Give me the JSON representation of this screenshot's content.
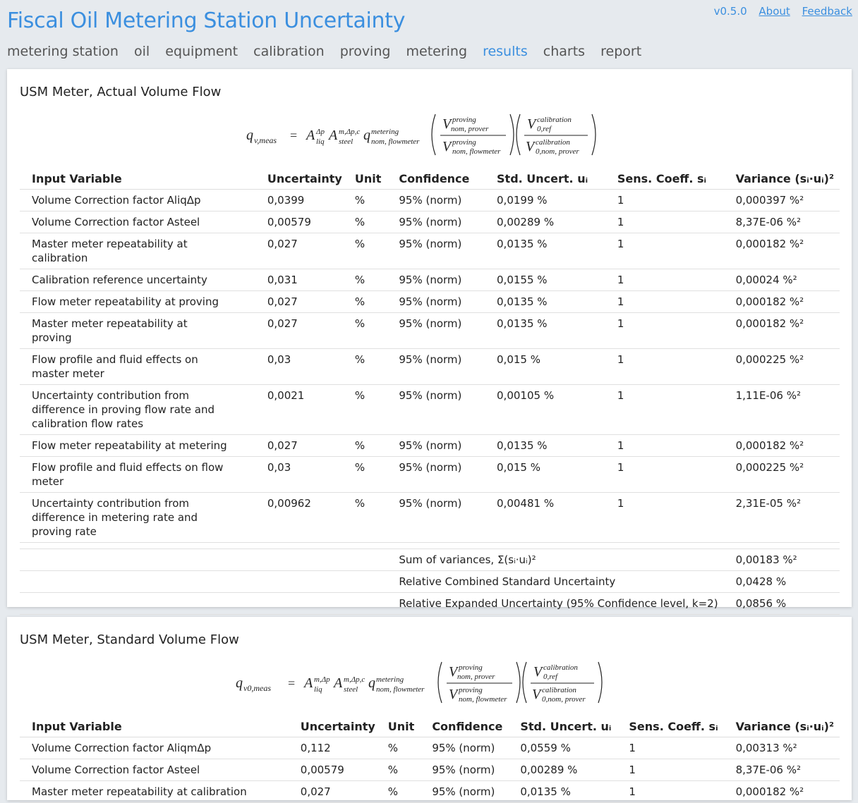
{
  "header": {
    "title": "Fiscal Oil Metering Station Uncertainty",
    "version": "v0.5.0",
    "about_label": "About",
    "feedback_label": "Feedback"
  },
  "nav": {
    "items": [
      "metering station",
      "oil",
      "equipment",
      "calibration",
      "proving",
      "metering",
      "results",
      "charts",
      "report"
    ],
    "active": "results"
  },
  "colors": {
    "accent": "#3b8fdf",
    "background": "#e6eaee",
    "card": "#ffffff"
  },
  "table_headers": {
    "input_variable": "Input Variable",
    "uncertainty": "Uncertainty",
    "unit": "Unit",
    "confidence": "Confidence",
    "std_uncert": "Std. Uncert. uᵢ",
    "sens_coeff": "Sens. Coeff. sᵢ",
    "variance": "Variance (sᵢ·uᵢ)²"
  },
  "cards": [
    {
      "title": "USM Meter, Actual Volume Flow",
      "formula_lhs": "q",
      "formula_lhs_sub": "v,meas",
      "rows": [
        {
          "name": "Volume Correction factor AliqΔp",
          "uncertainty": "0,0399",
          "unit": "%",
          "confidence": "95% (norm)",
          "std_uncert": "0,0199 %",
          "sens_coeff": "1",
          "variance": "0,000397 %²"
        },
        {
          "name": "Volume Correction factor Asteel",
          "uncertainty": "0,00579",
          "unit": "%",
          "confidence": "95% (norm)",
          "std_uncert": "0,00289 %",
          "sens_coeff": "1",
          "variance": "8,37E-06 %²"
        },
        {
          "name": "Master meter repeatability at calibration",
          "uncertainty": "0,027",
          "unit": "%",
          "confidence": "95% (norm)",
          "std_uncert": "0,0135 %",
          "sens_coeff": "1",
          "variance": "0,000182 %²"
        },
        {
          "name": "Calibration reference uncertainty",
          "uncertainty": "0,031",
          "unit": "%",
          "confidence": "95% (norm)",
          "std_uncert": "0,0155 %",
          "sens_coeff": "1",
          "variance": "0,00024 %²"
        },
        {
          "name": "Flow meter repeatability at proving",
          "uncertainty": "0,027",
          "unit": "%",
          "confidence": "95% (norm)",
          "std_uncert": "0,0135 %",
          "sens_coeff": "1",
          "variance": "0,000182 %²"
        },
        {
          "name": "Master meter repeatability at proving",
          "uncertainty": "0,027",
          "unit": "%",
          "confidence": "95% (norm)",
          "std_uncert": "0,0135 %",
          "sens_coeff": "1",
          "variance": "0,000182 %²"
        },
        {
          "name": "Flow profile and fluid effects on master meter",
          "uncertainty": "0,03",
          "unit": "%",
          "confidence": "95% (norm)",
          "std_uncert": "0,015 %",
          "sens_coeff": "1",
          "variance": "0,000225 %²"
        },
        {
          "name": "Uncertainty contribution from difference in proving flow rate and calibration flow rates",
          "uncertainty": "0,0021",
          "unit": "%",
          "confidence": "95% (norm)",
          "std_uncert": "0,00105 %",
          "sens_coeff": "1",
          "variance": "1,11E-06 %²"
        },
        {
          "name": "Flow meter repeatability at metering",
          "uncertainty": "0,027",
          "unit": "%",
          "confidence": "95% (norm)",
          "std_uncert": "0,0135 %",
          "sens_coeff": "1",
          "variance": "0,000182 %²"
        },
        {
          "name": "Flow profile and fluid effects on flow meter",
          "uncertainty": "0,03",
          "unit": "%",
          "confidence": "95% (norm)",
          "std_uncert": "0,015 %",
          "sens_coeff": "1",
          "variance": "0,000225 %²"
        },
        {
          "name": "Uncertainty contribution from difference in metering rate and proving rate",
          "uncertainty": "0,00962",
          "unit": "%",
          "confidence": "95% (norm)",
          "std_uncert": "0,00481 %",
          "sens_coeff": "1",
          "variance": "2,31E-05 %²"
        }
      ],
      "summary": [
        {
          "label": "Sum of variances, Σ(sᵢ·uᵢ)²",
          "value": "0,00183 %²"
        },
        {
          "label": "Relative Combined Standard Uncertainty",
          "value": "0,0428 %"
        },
        {
          "label": "Relative Expanded Uncertainty (95% Confidence level, k=2)",
          "value": "0,0856 %"
        }
      ]
    },
    {
      "title": "USM Meter, Standard Volume Flow",
      "formula_lhs": "q",
      "formula_lhs_sub": "v0,meas",
      "rows": [
        {
          "name": "Volume Correction factor AliqmΔp",
          "uncertainty": "0,112",
          "unit": "%",
          "confidence": "95% (norm)",
          "std_uncert": "0,0559 %",
          "sens_coeff": "1",
          "variance": "0,00313 %²"
        },
        {
          "name": "Volume Correction factor Asteel",
          "uncertainty": "0,00579",
          "unit": "%",
          "confidence": "95% (norm)",
          "std_uncert": "0,00289 %",
          "sens_coeff": "1",
          "variance": "8,37E-06 %²"
        },
        {
          "name": "Master meter repeatability at calibration",
          "uncertainty": "0,027",
          "unit": "%",
          "confidence": "95% (norm)",
          "std_uncert": "0,0135 %",
          "sens_coeff": "1",
          "variance": "0,000182 %²"
        }
      ],
      "summary": []
    }
  ]
}
